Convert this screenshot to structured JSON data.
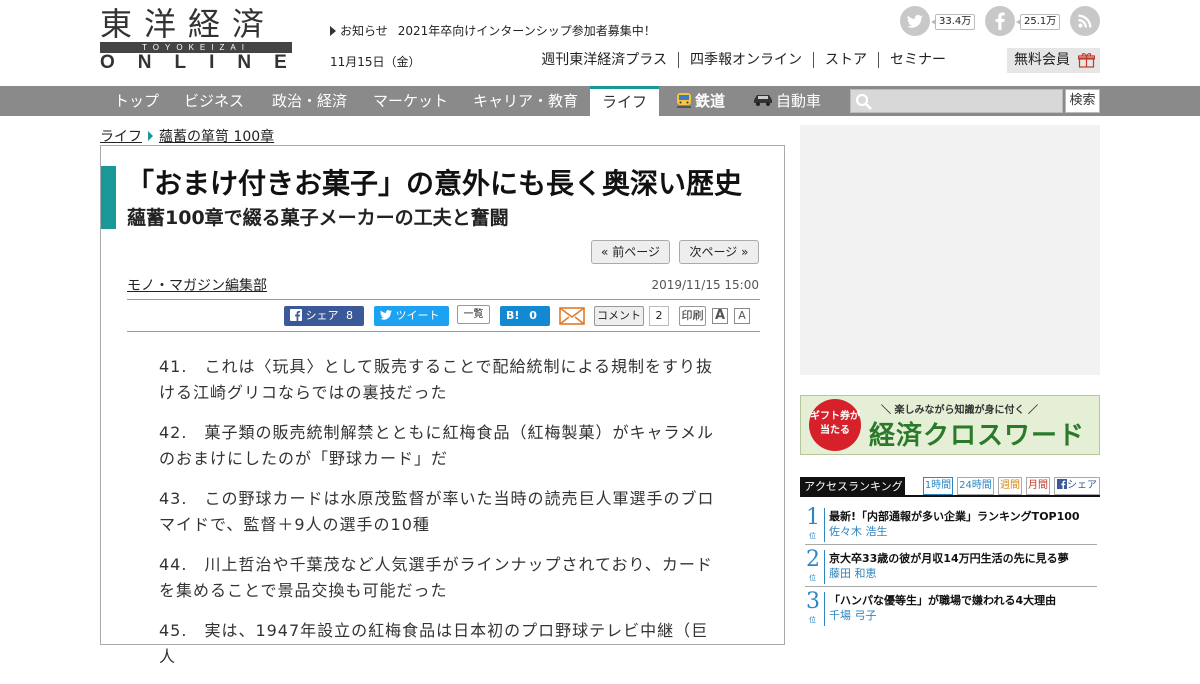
{
  "header": {
    "logo_kanji": "東洋経済",
    "logo_roman": "TOYOKEIZAI",
    "logo_online": "ONLINE",
    "notice_label": "お知らせ",
    "notice_text": "2021年卒向けインターンシップ参加者募集中！",
    "date": "11月15日（金）",
    "twitter_count": "33.4万",
    "facebook_count": "25.1万",
    "links": [
      "週刊東洋経済プラス",
      "四季報オンライン",
      "ストア",
      "セミナー"
    ],
    "free_member": "無料会員"
  },
  "nav": {
    "items": [
      "トップ",
      "ビジネス",
      "政治・経済",
      "マーケット",
      "キャリア・教育",
      "ライフ",
      "鉄道",
      "自動車"
    ],
    "active": "ライフ",
    "search_placeholder": "",
    "search_button": "検索"
  },
  "breadcrumb": [
    "ライフ",
    "蘊蓄の箪笥 100章"
  ],
  "article": {
    "title": "「おまけ付きお菓子」の意外にも長く奥深い歴史",
    "subtitle": "蘊蓄100章で綴る菓子メーカーの工夫と奮闘",
    "prev_page": "« 前ページ",
    "next_page": "次ページ »",
    "author": "モノ・マガジン編集部",
    "pubdate": "2019/11/15 15:00",
    "share": {
      "facebook_label": "シェア",
      "facebook_count": "8",
      "tweet_label": "ツイート",
      "ichiran": "一覧",
      "hatena_label": "B!",
      "hatena_count": "0",
      "comment_label": "コメント",
      "comment_count": "2",
      "print": "印刷",
      "font_large": "A",
      "font_small": "A"
    },
    "paragraphs": [
      "41.　これは〈玩具〉として販売することで配給統制による規制をすり抜ける江崎グリコならではの裏技だった",
      "42.　菓子類の販売統制解禁とともに紅梅食品（紅梅製菓）がキャラメルのおまけにしたのが「野球カード」だ",
      "43.　この野球カードは水原茂監督が率いた当時の読売巨人軍選手のブロマイドで、監督＋9人の選手の10種",
      "44.　川上哲治や千葉茂など人気選手がラインナップされており、カードを集めることで景品交換も可能だった",
      "45.　実は、1947年設立の紅梅食品は日本初のプロ野球テレビ中継（巨人"
    ]
  },
  "sidebar": {
    "banner_badge": "ギフト券が当たる",
    "banner_tagline": "＼ 楽しみながら知識が身に付く ／",
    "banner_headline": "経済クロスワード",
    "ranking_title": "アクセスランキング",
    "ranking_tabs": [
      "1時間",
      "24時間",
      "週間",
      "月間",
      "シェア"
    ],
    "ranking_pos_label": "位",
    "ranking": [
      {
        "rank": "1",
        "headline": "最新!「内部通報が多い企業」ランキングTOP100",
        "author": "佐々木 浩生"
      },
      {
        "rank": "2",
        "headline": "京大卒33歳の彼が月収14万円生活の先に見る夢",
        "author": "藤田 和恵"
      },
      {
        "rank": "3",
        "headline": "「ハンパな優等生」が職場で嫌われる4大理由",
        "author": "千場 弓子"
      }
    ]
  },
  "colors": {
    "accent_teal": "#1a9797",
    "nav_gray": "#8a8a8a",
    "rank_blue": "#2e86c1",
    "facebook": "#3b5998",
    "twitter": "#1da1f2",
    "hatena": "#1389d1"
  }
}
